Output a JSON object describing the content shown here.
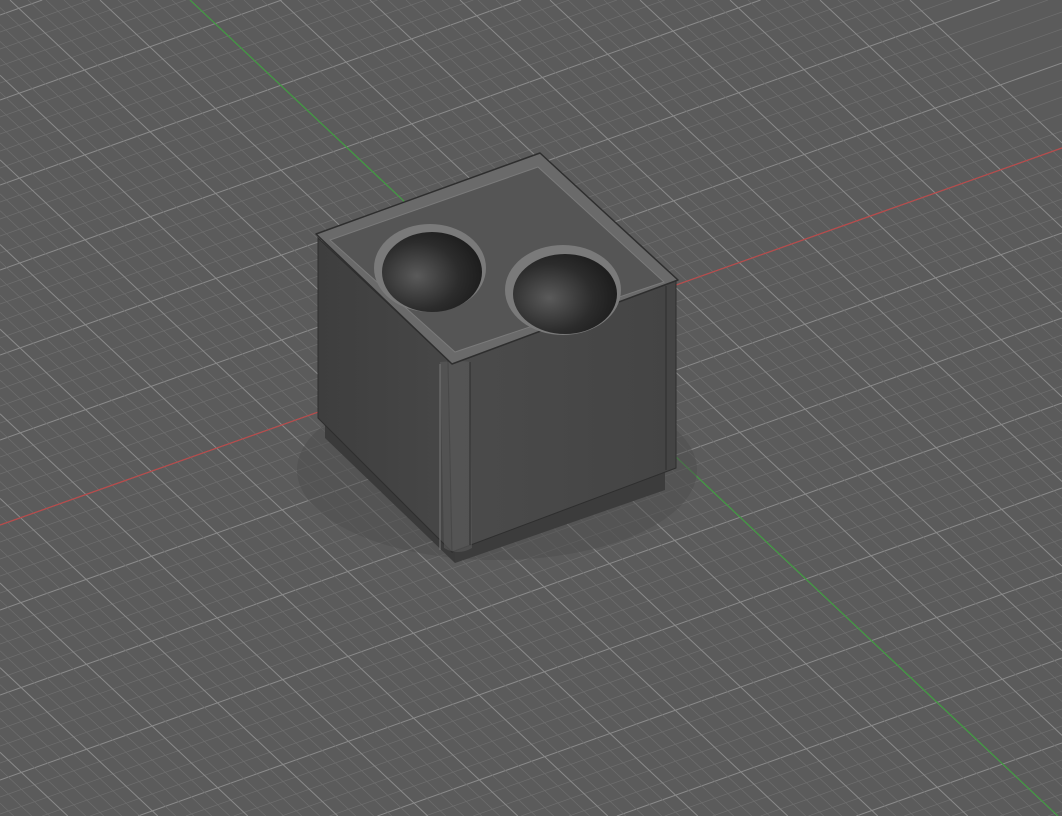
{
  "viewport": {
    "background_color": "#5b5b5b",
    "grid_minor_color": "#6e6e6e",
    "grid_major_color": "#8a8a8a",
    "x_axis_color": "#b84a4a",
    "y_axis_color": "#3f9a3f"
  },
  "model": {
    "body_color": "#4a4a4a",
    "top_face_color": "#555555",
    "hole_count": 2
  }
}
